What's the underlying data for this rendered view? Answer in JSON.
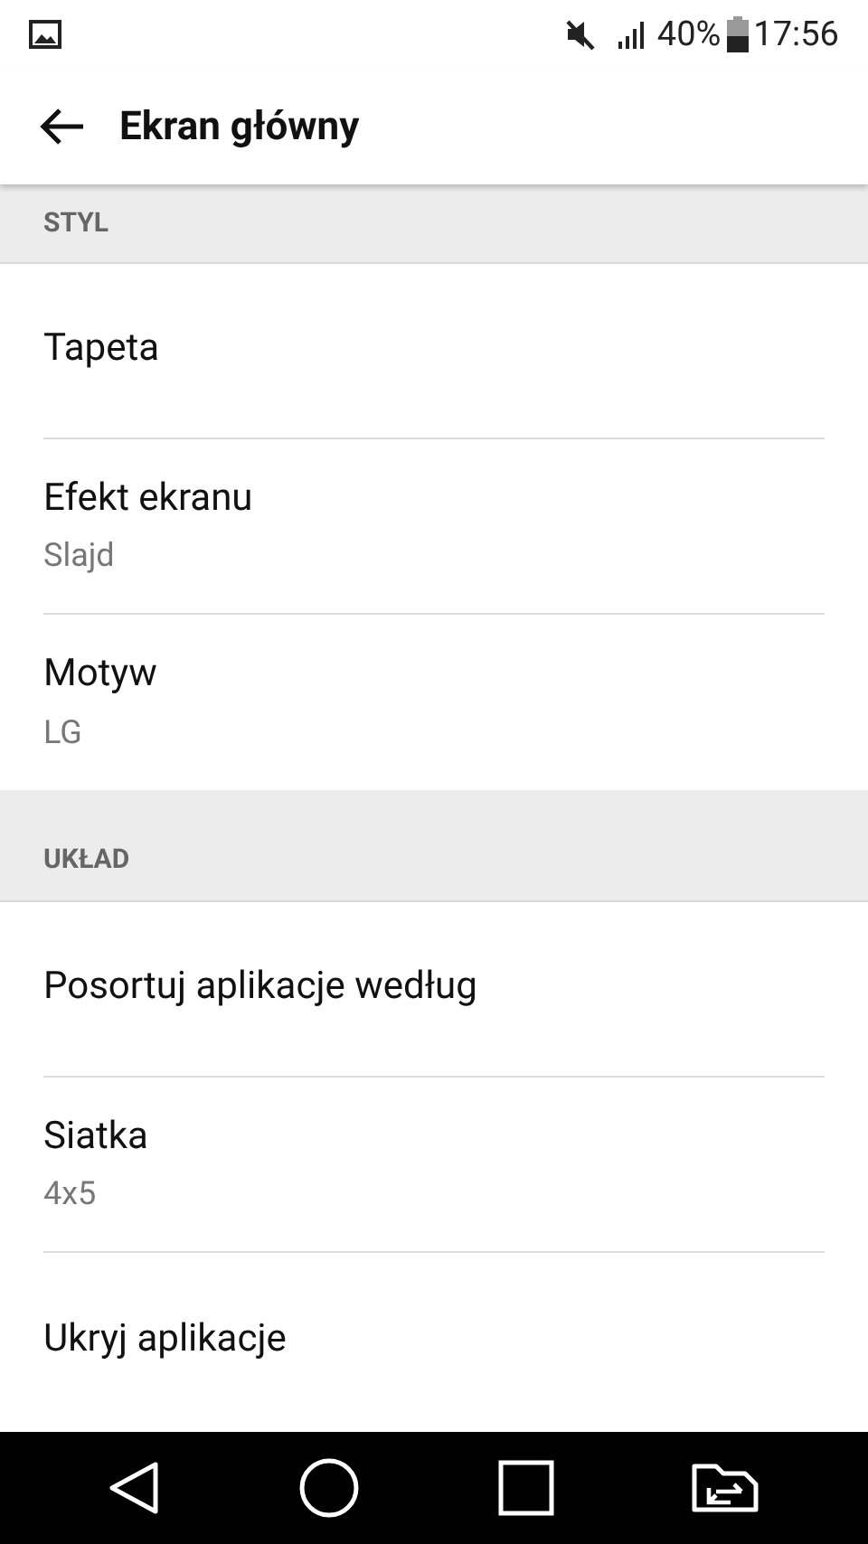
{
  "status_bar": {
    "battery": "40%",
    "time": "17:56"
  },
  "header": {
    "title": "Ekran główny"
  },
  "sections": [
    {
      "title": "STYL",
      "items": [
        {
          "title": "Tapeta"
        },
        {
          "title": "Efekt ekranu",
          "summary": "Slajd"
        },
        {
          "title": "Motyw",
          "summary": "LG"
        }
      ]
    },
    {
      "title": "UKŁAD",
      "items": [
        {
          "title": "Posortuj aplikacje według"
        },
        {
          "title": "Siatka",
          "summary": "4x5"
        },
        {
          "title": "Ukryj aplikacje"
        }
      ]
    }
  ]
}
